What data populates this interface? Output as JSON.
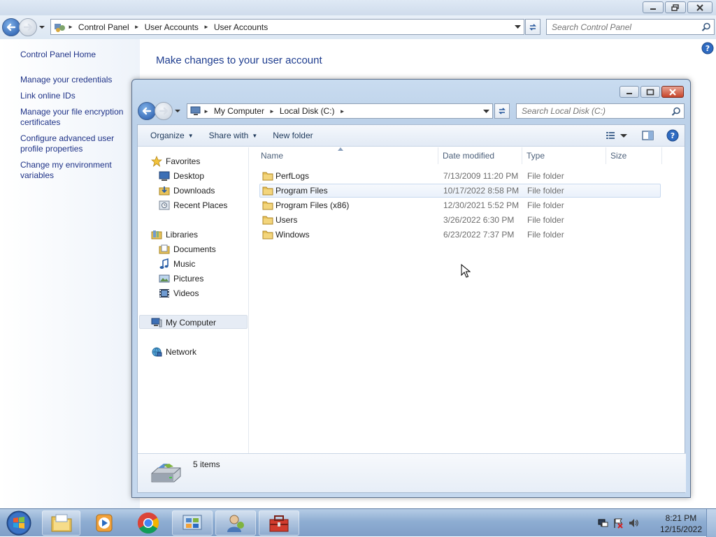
{
  "control_panel": {
    "address": [
      "Control Panel",
      "User Accounts",
      "User Accounts"
    ],
    "search_placeholder": "Search Control Panel",
    "left_links": [
      "Control Panel Home",
      "Manage your credentials",
      "Link online IDs",
      "Manage your file encryption certificates",
      "Configure advanced user profile properties",
      "Change my environment variables"
    ],
    "heading": "Make changes to your user account"
  },
  "explorer": {
    "address": [
      "My Computer",
      "Local Disk (C:)"
    ],
    "search_placeholder": "Search Local Disk (C:)",
    "toolbar": {
      "organize": "Organize",
      "share_with": "Share with",
      "new_folder": "New folder"
    },
    "nav": {
      "favorites": "Favorites",
      "favorites_items": [
        "Desktop",
        "Downloads",
        "Recent Places"
      ],
      "libraries": "Libraries",
      "libraries_items": [
        "Documents",
        "Music",
        "Pictures",
        "Videos"
      ],
      "computer": "My Computer",
      "network": "Network"
    },
    "columns": {
      "name": "Name",
      "date_modified": "Date modified",
      "type": "Type",
      "size": "Size"
    },
    "files": [
      {
        "name": "PerfLogs",
        "date": "7/13/2009 11:20 PM",
        "type": "File folder"
      },
      {
        "name": "Program Files",
        "date": "10/17/2022 8:58 PM",
        "type": "File folder"
      },
      {
        "name": "Program Files (x86)",
        "date": "12/30/2021 5:52 PM",
        "type": "File folder"
      },
      {
        "name": "Users",
        "date": "3/26/2022 6:30 PM",
        "type": "File folder"
      },
      {
        "name": "Windows",
        "date": "6/23/2022 7:37 PM",
        "type": "File folder"
      }
    ],
    "status": "5 items"
  },
  "taskbar": {
    "time": "8:21 PM",
    "date": "12/15/2022",
    "icons": [
      "start-orb-icon",
      "explorer-icon",
      "media-player-icon",
      "chrome-icon",
      "control-panel-icon",
      "user-accounts-icon",
      "toolbox-icon"
    ]
  },
  "colors": {
    "link": "#1e3287",
    "heading": "#1e3d8f",
    "titlebar": "#c9dcf0",
    "taskbar": "#8eadd2",
    "selected_row": "#eaf1fb"
  }
}
